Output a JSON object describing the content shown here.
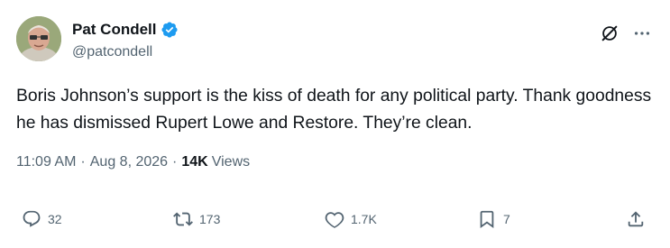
{
  "author": {
    "display_name": "Pat Condell",
    "handle": "@patcondell"
  },
  "icons": {
    "verified": "verified-badge-icon",
    "grok": "grok-icon",
    "more": "more-icon"
  },
  "tweet": {
    "text": "Boris Johnson’s support is the kiss of death for any political party. Thank goodness he has dismissed Rupert Lowe and Restore. They’re clean."
  },
  "meta": {
    "time": "11:09 AM",
    "separator": "·",
    "date": "Aug 8, 2026",
    "views_count": "14K",
    "views_label": "Views"
  },
  "actions": {
    "replies": "32",
    "reposts": "173",
    "likes": "1.7K",
    "bookmarks": "7"
  },
  "colors": {
    "verified": "#1d9bf0",
    "secondary_text": "#536471",
    "primary_text": "#0f1419"
  }
}
